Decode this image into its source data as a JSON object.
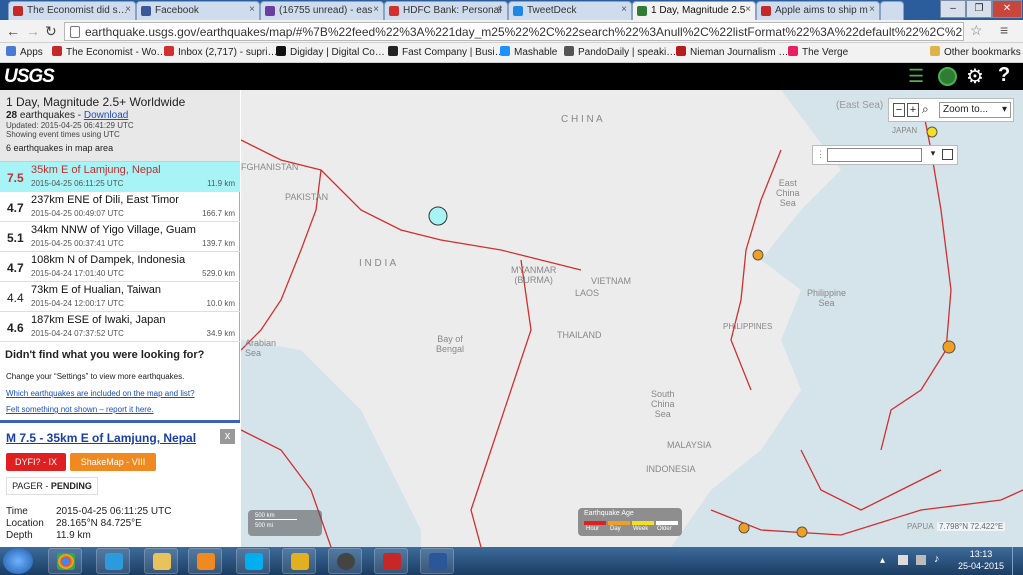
{
  "browser": {
    "tabs": [
      {
        "label": "The Economist did s…",
        "color": "#c62828"
      },
      {
        "label": "Facebook",
        "color": "#3b5998"
      },
      {
        "label": "(16755 unread) - eas",
        "color": "#6a3fa0"
      },
      {
        "label": "HDFC Bank: Personal",
        "color": "#d32f2f"
      },
      {
        "label": "TweetDeck",
        "color": "#1e88e5"
      },
      {
        "label": "1 Day, Magnitude 2.5",
        "color": "#2e7d32"
      },
      {
        "label": "Apple aims to ship m",
        "color": "#c62828"
      }
    ],
    "url": "earthquake.usgs.gov/earthquakes/map/#%7B%22feed%22%3A%221day_m25%22%2C%22search%22%3Anull%2C%22listFormat%22%3A%22default%22%2C%22sort%2",
    "bookmarks": [
      {
        "label": "Apps",
        "color": "#4a7ad6"
      },
      {
        "label": "The Economist - Wo…",
        "color": "#c62828"
      },
      {
        "label": "Inbox (2,717) - supri…",
        "color": "#d32f2f"
      },
      {
        "label": "Digiday | Digital Co…",
        "color": "#111"
      },
      {
        "label": "Fast Company | Busi…",
        "color": "#222"
      },
      {
        "label": "Mashable",
        "color": "#1e90ff"
      },
      {
        "label": "PandoDaily | speaki…",
        "color": "#555"
      },
      {
        "label": "Nieman Journalism …",
        "color": "#b71c1c"
      },
      {
        "label": "The Verge",
        "color": "#e91e63"
      },
      {
        "label": "Other bookmarks",
        "color": "#e0b34a"
      }
    ]
  },
  "header": {
    "logo": "USGS"
  },
  "sidebar": {
    "title": "1 Day, Magnitude 2.5+ Worldwide",
    "count": "28",
    "count_label": "earthquakes",
    "download_sep": "-",
    "download": "Download",
    "updated": "Updated: 2015-04-25 06:41:29 UTC",
    "event_times": "Showing event times using UTC",
    "in_map": "6 earthquakes in map area",
    "list": [
      {
        "mag": "7.5",
        "title": "35km E of Lamjung, Nepal",
        "time": "2015-04-25 06:11:25 UTC",
        "depth": "11.9 km",
        "selected": true
      },
      {
        "mag": "4.7",
        "title": "237km ENE of Dili, East Timor",
        "time": "2015-04-25 00:49:07 UTC",
        "depth": "166.7 km"
      },
      {
        "mag": "5.1",
        "title": "34km NNW of Yigo Village, Guam",
        "time": "2015-04-25 00:37:41 UTC",
        "depth": "139.7 km"
      },
      {
        "mag": "4.7",
        "title": "108km N of Dampek, Indonesia",
        "time": "2015-04-24 17:01:40 UTC",
        "depth": "529.0 km"
      },
      {
        "mag": "4.4",
        "title": "73km E of Hualian, Taiwan",
        "time": "2015-04-24 12:00:17 UTC",
        "depth": "10.0 km"
      },
      {
        "mag": "4.6",
        "title": "187km ESE of Iwaki, Japan",
        "time": "2015-04-24 07:37:52 UTC",
        "depth": "34.9 km"
      }
    ],
    "not_found": "Didn't find what you were looking for?",
    "change_settings": "Change your “Settings” to view more earthquakes.",
    "which_link": "Which earthquakes are included on the map and list?",
    "felt_link": "Felt something not shown – report it here."
  },
  "detail": {
    "title": "M 7.5 - 35km E of Lamjung, Nepal",
    "dyfi": "DYFI? - IX",
    "shakemap": "ShakeMap - VIII",
    "pager": "PAGER -",
    "pager_status": "PENDING",
    "time_label": "Time",
    "time": "2015-04-25 06:11:25 UTC",
    "loc_label": "Location",
    "loc": "28.165°N 84.725°E",
    "depth_label": "Depth",
    "depth": "11.9 km",
    "close": "x"
  },
  "map": {
    "zoom_select": "Zoom to...",
    "zoom_minus": "−",
    "zoom_plus": "+",
    "labels": {
      "east_sea": "(East Sea)",
      "japan": "JAPAN",
      "china": "C H I N A",
      "afghanistan": "AFGHANISTAN",
      "pakistan": "PAKISTAN",
      "india": "I N D I A",
      "myanmar": "MYANMAR\n(BURMA)",
      "vietnam": "VIETNAM",
      "laos": "LAOS",
      "thailand": "THAILAND",
      "philippines": "PHILIPPINES",
      "east_china": "East\nChina\nSea",
      "philippine_sea": "Philippine\nSea",
      "arabian": "Arabian\nSea",
      "bengal": "Bay of\nBengal",
      "south_china": "South\nChina\nSea",
      "malaysia": "MALAYSIA",
      "indonesia": "INDONESIA",
      "papua": "PAPUA"
    },
    "scale_top": "500 km",
    "scale_bottom": "500 mi",
    "legend_title": "Earthquake Age",
    "legend_items": [
      "Hour",
      "Day",
      "Week",
      "Older"
    ],
    "legend_colors": [
      "#e02020",
      "#f0a020",
      "#f5e020",
      "#ffffff"
    ],
    "coords": "7.798°N 72.422°E"
  },
  "taskbar": {
    "time": "13:13",
    "date": "25-04-2015"
  }
}
